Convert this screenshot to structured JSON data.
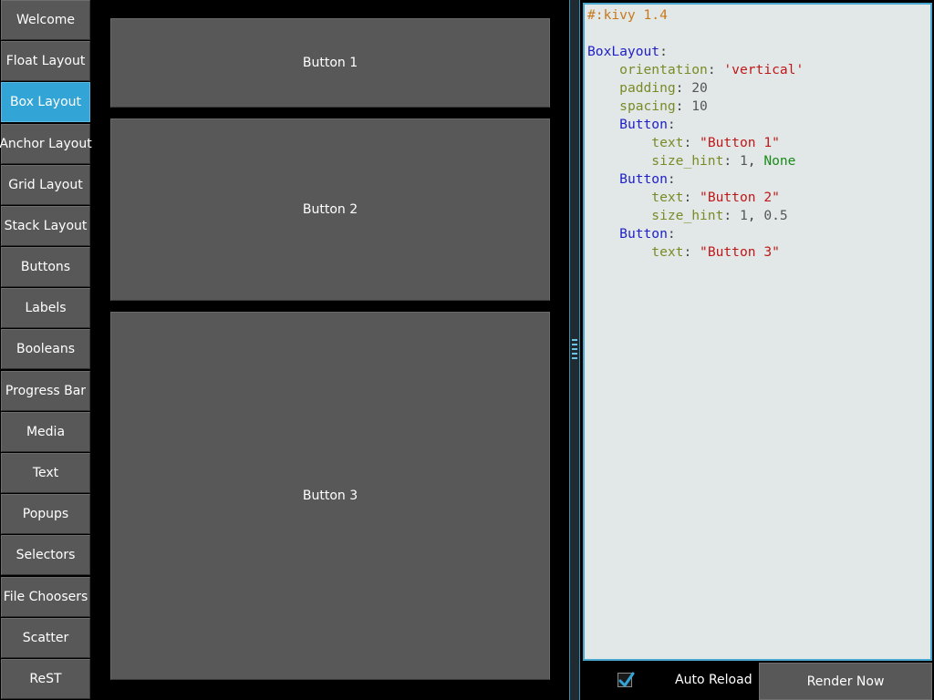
{
  "sidebar": {
    "items": [
      {
        "label": "Welcome",
        "active": false
      },
      {
        "label": "Float Layout",
        "active": false
      },
      {
        "label": "Box Layout",
        "active": true
      },
      {
        "label": "Anchor Layout",
        "active": false
      },
      {
        "label": "Grid Layout",
        "active": false
      },
      {
        "label": "Stack Layout",
        "active": false
      },
      {
        "label": "Buttons",
        "active": false
      },
      {
        "label": "Labels",
        "active": false
      },
      {
        "label": "Booleans",
        "active": false
      },
      {
        "label": "Progress Bar",
        "active": false
      },
      {
        "label": "Media",
        "active": false
      },
      {
        "label": "Text",
        "active": false
      },
      {
        "label": "Popups",
        "active": false
      },
      {
        "label": "Selectors",
        "active": false
      },
      {
        "label": "File Choosers",
        "active": false
      },
      {
        "label": "Scatter",
        "active": false
      },
      {
        "label": "ReST",
        "active": false
      }
    ]
  },
  "demo": {
    "button1": "Button 1",
    "button2": "Button 2",
    "button3": "Button 3"
  },
  "editor": {
    "code": {
      "header": "#:kivy 1.4",
      "root_class": "BoxLayout",
      "orientation_key": "orientation",
      "orientation_value": "'vertical'",
      "padding_key": "padding",
      "padding_value": "20",
      "spacing_key": "spacing",
      "spacing_value": "10",
      "button_class": "Button",
      "text_key": "text",
      "b1_text": "\"Button 1\"",
      "size_hint_key": "size_hint",
      "b1_size_hint_x": "1",
      "b1_size_hint_y": "None",
      "b2_text": "\"Button 2\"",
      "b2_size_hint_x": "1",
      "b2_size_hint_y": "0.5",
      "b3_text": "\"Button 3\""
    }
  },
  "bottom_bar": {
    "auto_reload_label": "Auto Reload",
    "auto_reload_checked": true,
    "render_button": "Render Now"
  },
  "colors": {
    "accent": "#33a4d6",
    "button_bg": "#585858",
    "editor_bg": "#e2e8e8"
  }
}
